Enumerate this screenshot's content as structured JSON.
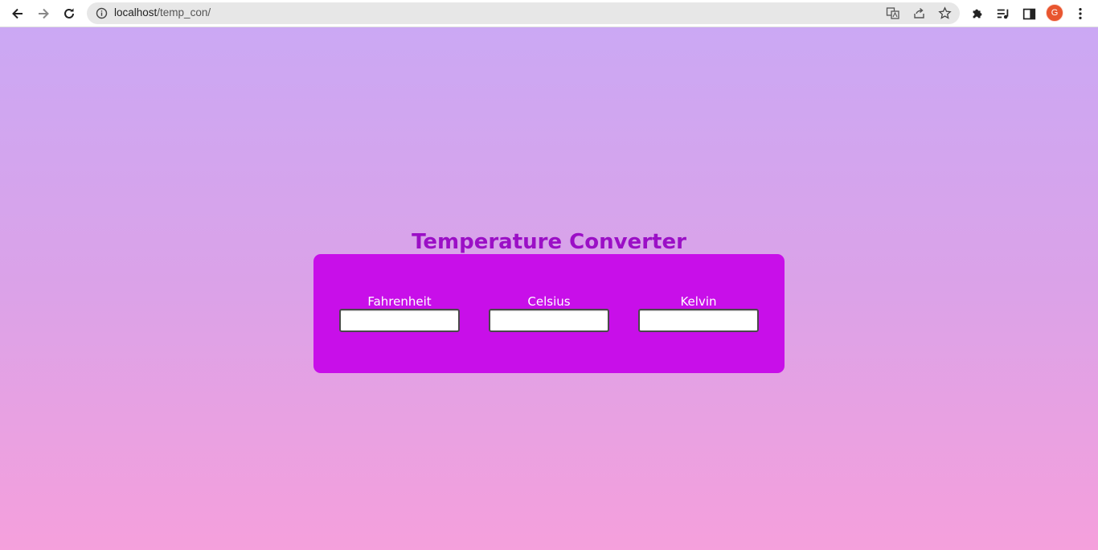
{
  "browser": {
    "url_host": "localhost",
    "url_path": "/temp_con/",
    "profile_initial": "G",
    "icons": [
      "back-icon",
      "forward-icon",
      "reload-icon",
      "info-icon",
      "translate-icon",
      "share-icon",
      "star-icon",
      "extensions-icon",
      "media-icon",
      "side-panel-icon",
      "menu-icon"
    ],
    "colors": {
      "avatar": "#e8552f",
      "omnibox": "#e7e7e7"
    }
  },
  "page": {
    "title": "Temperature Converter",
    "fields": [
      {
        "label": "Fahrenheit",
        "value": ""
      },
      {
        "label": "Celsius",
        "value": ""
      },
      {
        "label": "Kelvin",
        "value": ""
      }
    ],
    "colors": {
      "title": "#9b0fc6",
      "card": "#c80fe9",
      "gradient_top": "#cba8f4",
      "gradient_bottom": "#f5a0dc"
    }
  }
}
